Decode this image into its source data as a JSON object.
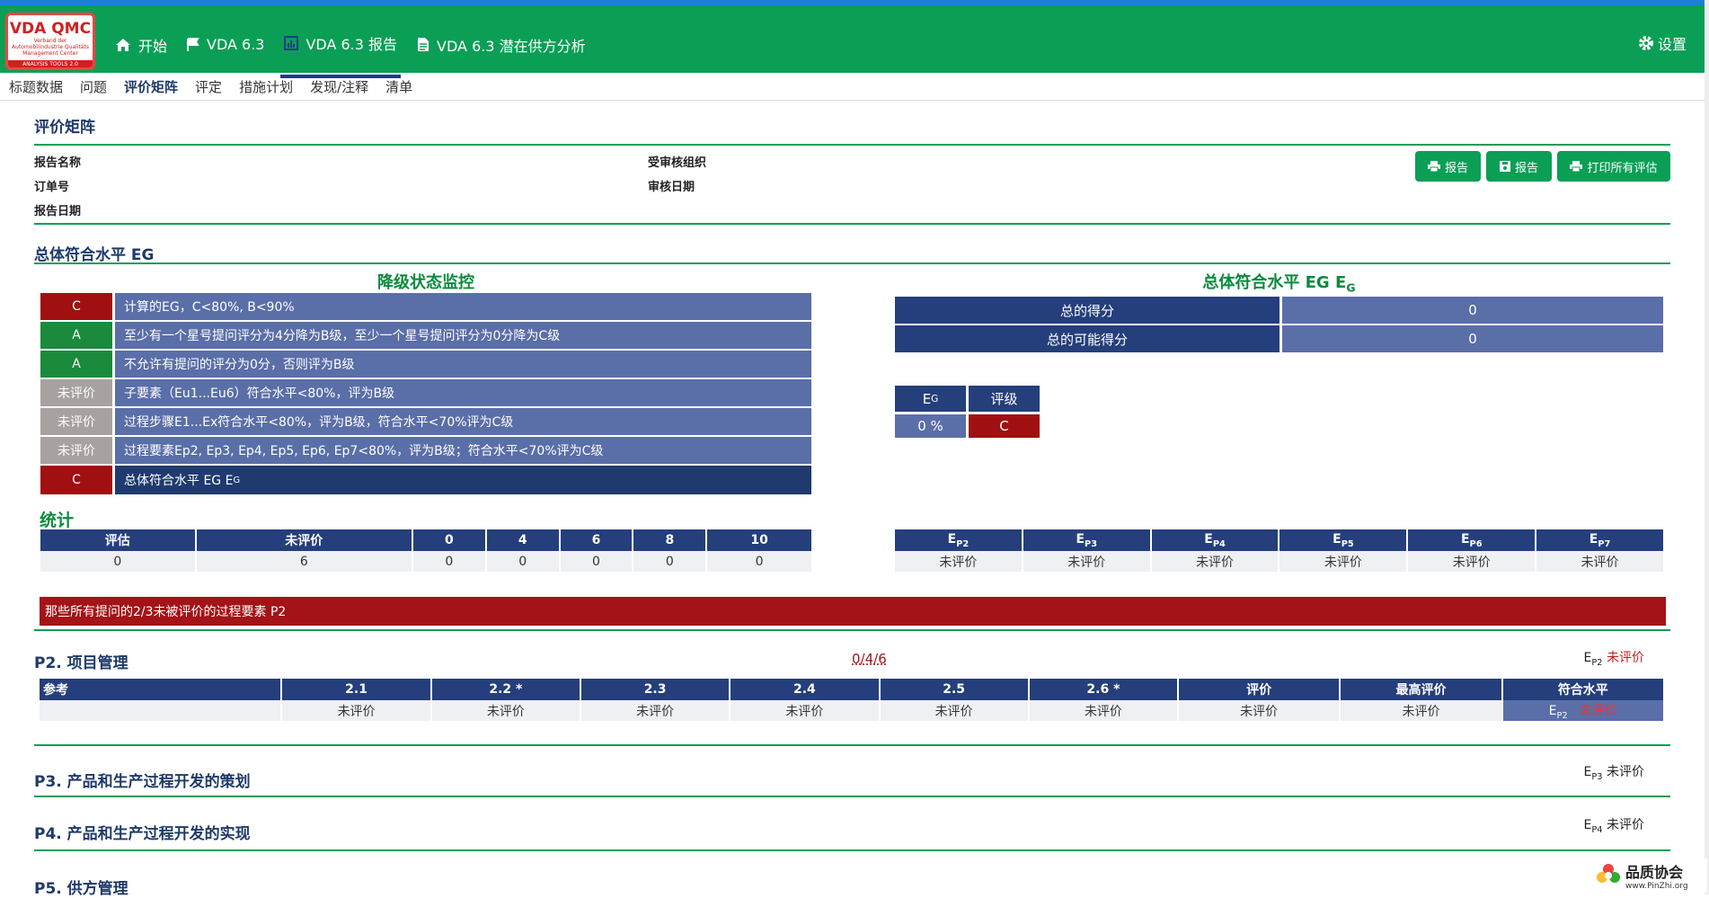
{
  "logo": {
    "line1": "VDA QMC",
    "line2": "Verband der Automobilindustrie Qualitäts Management Center",
    "line3": "ANALYSIS TOOLS 2.0"
  },
  "nav": [
    {
      "label": "开始",
      "icon": "home-icon"
    },
    {
      "label": "VDA 6.3",
      "icon": "flag-icon"
    },
    {
      "label": "VDA 6.3 报告",
      "icon": "chart-icon"
    },
    {
      "label": "VDA 6.3 潜在供方分析",
      "icon": "document-icon"
    }
  ],
  "settings_label": "设置",
  "subnav": [
    "标题数据",
    "问题",
    "评价矩阵",
    "评定",
    "措施计划",
    "发现/注释",
    "清单"
  ],
  "page_title": "评价矩阵",
  "meta": {
    "report_name": "报告名称",
    "order_no": "订单号",
    "report_date": "报告日期",
    "audited_org": "受审核组织",
    "audit_date": "审核日期"
  },
  "buttons": {
    "report1": "报告",
    "report2": "报告",
    "print_all": "打印所有评估"
  },
  "eg_section_title": "总体符合水平 EG",
  "monitor": {
    "title": "降级状态监控",
    "rows": [
      {
        "grade": "C",
        "text": "计算的EG，C<80%, B<90%"
      },
      {
        "grade": "A",
        "text": "至少有一个星号提问评分为4分降为B级，至少一个星号提问评分为0分降为C级"
      },
      {
        "grade": "A",
        "text": "不允许有提问的评分为0分，否则评为B级"
      },
      {
        "grade": "未评价",
        "text": "子要素（Eu1...Eu6）符合水平<80%，评为B级"
      },
      {
        "grade": "未评价",
        "text": "过程步骤E1...Ex符合水平<80%，评为B级，符合水平<70%评为C级"
      },
      {
        "grade": "未评价",
        "text": "过程要素Ep2, Ep3, Ep4, Ep5, Ep6, Ep7<80%，评为B级；符合水平<70%评为C级"
      },
      {
        "grade": "C",
        "text": "总体符合水平 EG E",
        "sub": "G"
      }
    ]
  },
  "overall": {
    "title": "总体符合水平 EG E",
    "title_sub": "G",
    "total_score_label": "总的得分",
    "total_score": "0",
    "possible_label": "总的可能得分",
    "possible": "0",
    "eg_label": "E",
    "eg_sub": "G",
    "rating_label": "评级",
    "eg_value": "0 %",
    "rating_value": "C"
  },
  "stats": {
    "title": "统计",
    "headers": [
      "评估",
      "未评价",
      "0",
      "4",
      "6",
      "8",
      "10"
    ],
    "values": [
      "0",
      "6",
      "0",
      "0",
      "0",
      "0",
      "0"
    ]
  },
  "ep_table": {
    "headers": [
      {
        "main": "E",
        "sub": "P2"
      },
      {
        "main": "E",
        "sub": "P3"
      },
      {
        "main": "E",
        "sub": "P4"
      },
      {
        "main": "E",
        "sub": "P5"
      },
      {
        "main": "E",
        "sub": "P6"
      },
      {
        "main": "E",
        "sub": "P7"
      }
    ],
    "values": [
      "未评价",
      "未评价",
      "未评价",
      "未评价",
      "未评价",
      "未评价"
    ]
  },
  "alert": "那些所有提问的2/3未被评价的过程要素 P2",
  "p2": {
    "title": "P2. 项目管理",
    "counter": "0/4/6",
    "ep_label": "E",
    "ep_sub": "P2",
    "ep_status": "未评价",
    "headers": [
      "参考",
      "2.1",
      "2.2 *",
      "2.3",
      "2.4",
      "2.5",
      "2.6 *",
      "评价",
      "最高评价",
      "符合水平"
    ],
    "values": [
      "",
      "未评价",
      "未评价",
      "未评价",
      "未评价",
      "未评价",
      "未评价",
      "未评价",
      "未评价"
    ],
    "level_label": "E",
    "level_sub": "P2",
    "level_status": "未评价"
  },
  "sections": [
    {
      "title": "P3. 产品和生产过程开发的策划",
      "ep": "E",
      "sub": "P3",
      "status": "未评价"
    },
    {
      "title": "P4. 产品和生产过程开发的实现",
      "ep": "E",
      "sub": "P4",
      "status": "未评价"
    },
    {
      "title": "P5. 供方管理",
      "ep": "",
      "sub": "",
      "status": ""
    }
  ],
  "watermark": {
    "line1": "品质协会",
    "line2": "www.PinZhi.org"
  }
}
